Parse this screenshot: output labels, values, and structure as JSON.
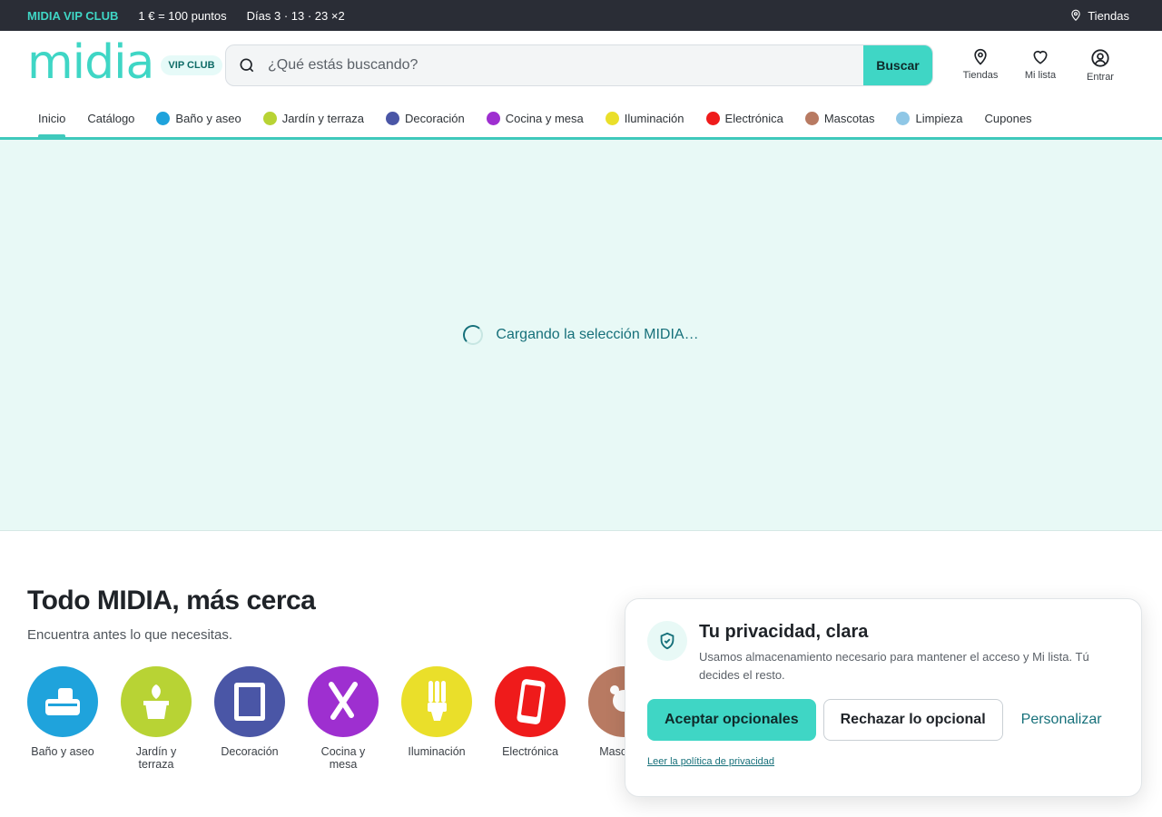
{
  "topbar": {
    "club": "MIDIA VIP CLUB",
    "points": "1 € = 100 puntos",
    "days": "Días 3 · 13 · 23 ×2",
    "stores": "Tiendas"
  },
  "header": {
    "logo": "midia",
    "vip_badge": "VIP CLUB",
    "search_placeholder": "¿Qué estás buscando?",
    "search_button": "Buscar",
    "actions": {
      "stores": "Tiendas",
      "wishlist": "Mi lista",
      "login": "Entrar"
    }
  },
  "nav": {
    "items": [
      {
        "label": "Inicio",
        "color": ""
      },
      {
        "label": "Catálogo",
        "color": ""
      },
      {
        "label": "Baño y aseo",
        "color": "#1fa3dc"
      },
      {
        "label": "Jardín y terraza",
        "color": "#b8d334"
      },
      {
        "label": "Decoración",
        "color": "#4a56a6"
      },
      {
        "label": "Cocina y mesa",
        "color": "#9e2fd0"
      },
      {
        "label": "Iluminación",
        "color": "#eadf2a"
      },
      {
        "label": "Electrónica",
        "color": "#ef1b1b"
      },
      {
        "label": "Mascotas",
        "color": "#b87a62"
      },
      {
        "label": "Limpieza",
        "color": "#8fc7e6"
      },
      {
        "label": "Cupones",
        "color": ""
      }
    ]
  },
  "hero": {
    "loading_text": "Cargando la selección MIDIA…"
  },
  "section": {
    "title": "Todo MIDIA, más cerca",
    "subtitle": "Encuentra antes lo que necesitas.",
    "categories": [
      {
        "label": "Baño y aseo",
        "color": "#1fa3dc",
        "icon": "soap-icon"
      },
      {
        "label": "Jardín y terraza",
        "color": "#b8d334",
        "icon": "plant-pot-icon"
      },
      {
        "label": "Decoración",
        "color": "#4a56a6",
        "icon": "frame-icon"
      },
      {
        "label": "Cocina y mesa",
        "color": "#9e2fd0",
        "icon": "cutlery-icon"
      },
      {
        "label": "Iluminación",
        "color": "#eadf2a",
        "icon": "bulb-icon"
      },
      {
        "label": "Electrónica",
        "color": "#ef1b1b",
        "icon": "phone-icon"
      },
      {
        "label": "Mascotas",
        "color": "#b87a62",
        "icon": "pet-icon"
      }
    ]
  },
  "privacy": {
    "title": "Tu privacidad, clara",
    "text": "Usamos almacenamiento necesario para mantener el acceso y Mi lista. Tú decides el resto.",
    "accept": "Aceptar opcionales",
    "reject": "Rechazar lo opcional",
    "customize": "Personalizar",
    "policy_link": "Leer la política de privacidad"
  }
}
